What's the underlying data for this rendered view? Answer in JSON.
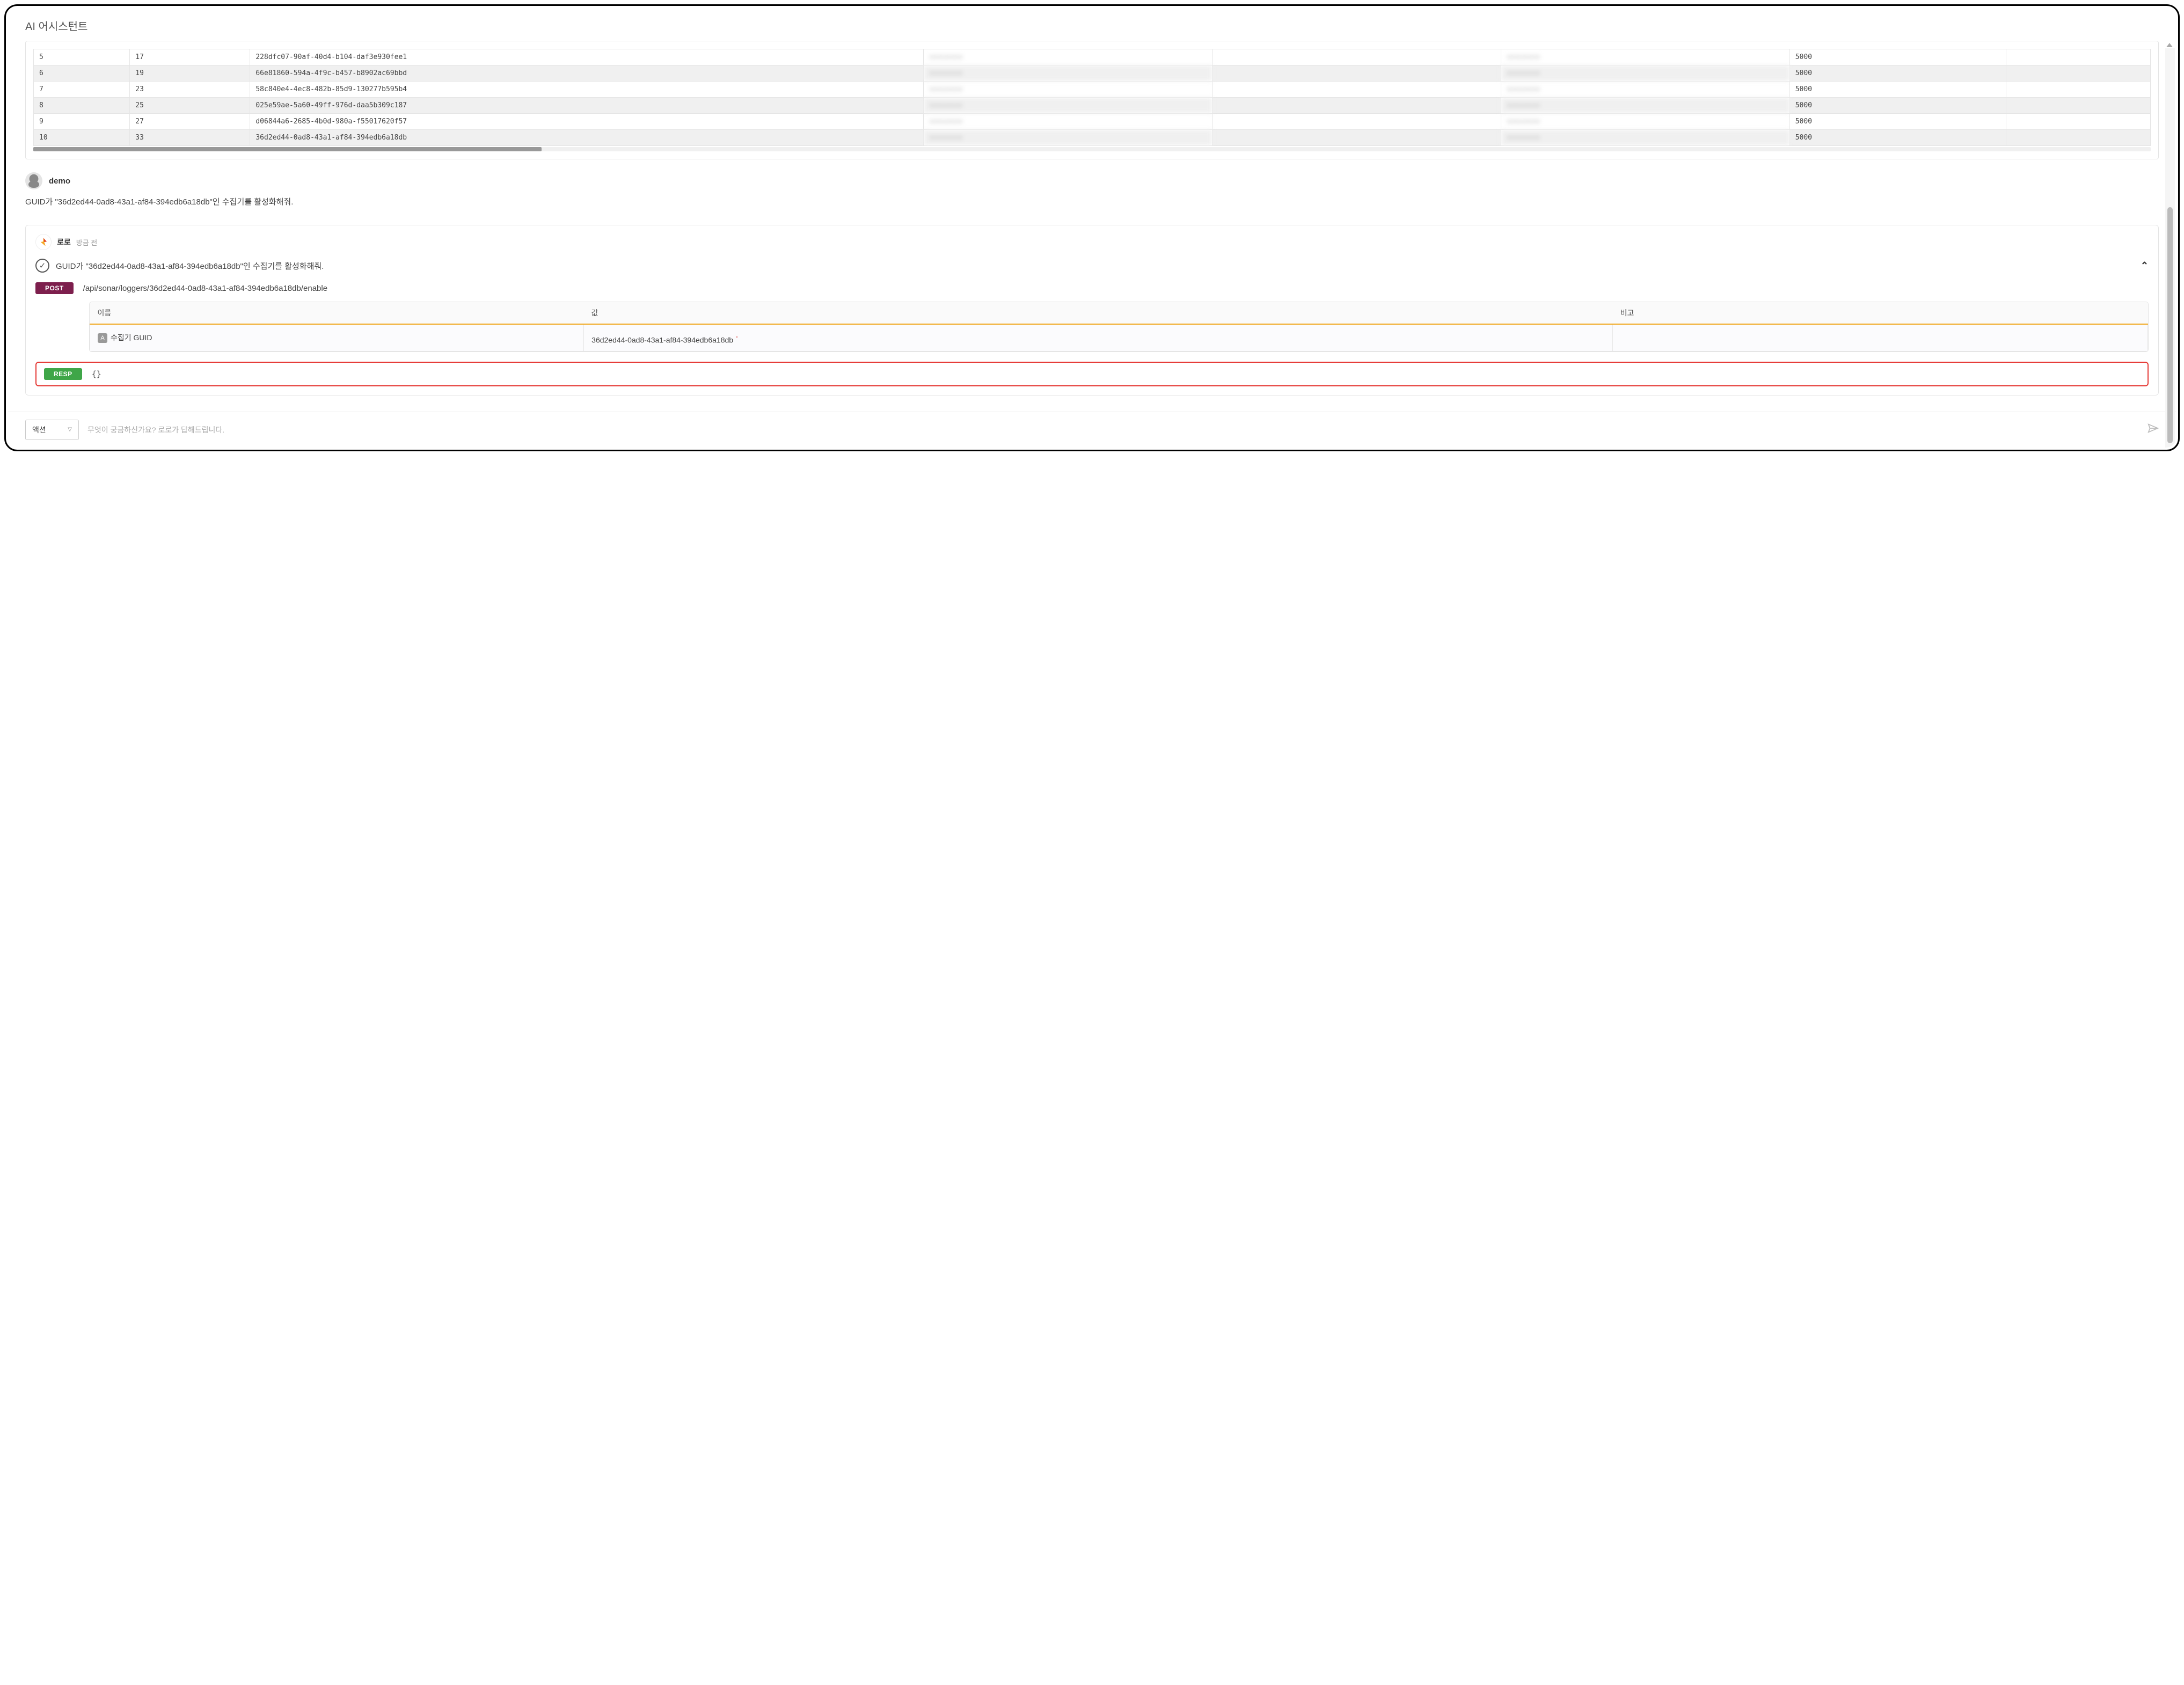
{
  "page_title": "AI 어시스턴트",
  "table": {
    "rows": [
      {
        "a": "5",
        "b": "17",
        "guid": "228dfc07-90af-40d4-b104-daf3e930fee1",
        "c": "",
        "d": "",
        "e": "",
        "f": "5000",
        "stripe": false
      },
      {
        "a": "6",
        "b": "19",
        "guid": "66e81860-594a-4f9c-b457-b8902ac69bbd",
        "c": "",
        "d": "",
        "e": "",
        "f": "5000",
        "stripe": true
      },
      {
        "a": "7",
        "b": "23",
        "guid": "58c840e4-4ec8-482b-85d9-130277b595b4",
        "c": "",
        "d": "",
        "e": "",
        "f": "5000",
        "stripe": false
      },
      {
        "a": "8",
        "b": "25",
        "guid": "025e59ae-5a60-49ff-976d-daa5b309c187",
        "c": "",
        "d": "",
        "e": "",
        "f": "5000",
        "stripe": true
      },
      {
        "a": "9",
        "b": "27",
        "guid": "d06844a6-2685-4b0d-980a-f55017620f57",
        "c": "",
        "d": "",
        "e": "",
        "f": "5000",
        "stripe": false
      },
      {
        "a": "10",
        "b": "33",
        "guid": "36d2ed44-0ad8-43a1-af84-394edb6a18db",
        "c": "",
        "d": "",
        "e": "",
        "f": "5000",
        "stripe": true
      }
    ]
  },
  "user": {
    "name": "demo",
    "message": "GUID가 \"36d2ed44-0ad8-43a1-af84-394edb6a18db\"인 수집기를 활성화해줘."
  },
  "bot": {
    "name": "로로",
    "time": "방금 전",
    "task": "GUID가 \"36d2ed44-0ad8-43a1-af84-394edb6a18db\"인 수집기를 활성화해줘.",
    "request": {
      "method": "POST",
      "path": "/api/sonar/loggers/36d2ed44-0ad8-43a1-af84-394edb6a18db/enable",
      "headers": {
        "name": "이름",
        "value": "값",
        "note": "비고"
      },
      "param_badge": "A",
      "param_name": "수집기 GUID",
      "param_value": "36d2ed44-0ad8-43a1-af84-394edb6a18db"
    },
    "response": {
      "label": "RESP",
      "body": "{}"
    }
  },
  "footer": {
    "action_label": "액션",
    "placeholder": "무엇이 궁금하신가요? 로로가 답해드립니다."
  }
}
